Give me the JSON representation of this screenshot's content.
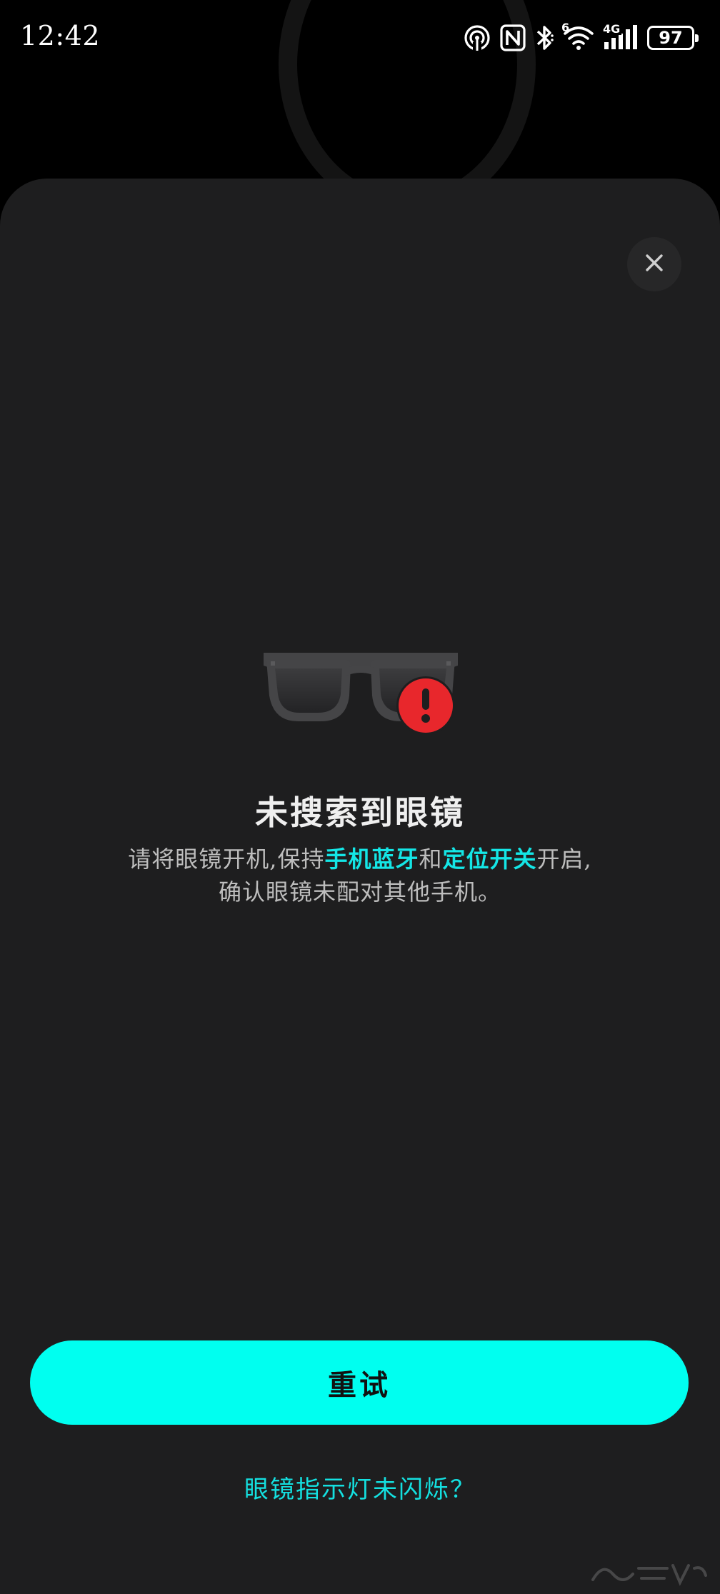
{
  "status_bar": {
    "time": "12:42",
    "battery": "97",
    "network_label": "4G",
    "wifi_badge": "6",
    "icons": [
      "hotspot-icon",
      "nfc-icon",
      "bluetooth-icon",
      "wifi-icon",
      "cellular-signal-icon",
      "battery-icon"
    ]
  },
  "dialog": {
    "close_icon": "close-icon",
    "illustration": {
      "glasses_icon": "glasses-icon",
      "alert_icon": "alert-icon",
      "alert_mark": "!",
      "alert_color": "#e8272c"
    },
    "title": "未搜索到眼镜",
    "description": {
      "part1": "请将眼镜开机,保持",
      "highlight1": "手机蓝牙",
      "part2": "和",
      "highlight2": "定位开关",
      "part3": "开启,",
      "line2": "确认眼镜未配对其他手机。"
    },
    "retry_label": "重试",
    "help_link": "眼镜指示灯未闪烁？"
  },
  "colors": {
    "accent": "#00fff0",
    "highlight_text": "#14e6e6",
    "sheet_background": "#1e1e1f",
    "page_background": "#000000"
  }
}
